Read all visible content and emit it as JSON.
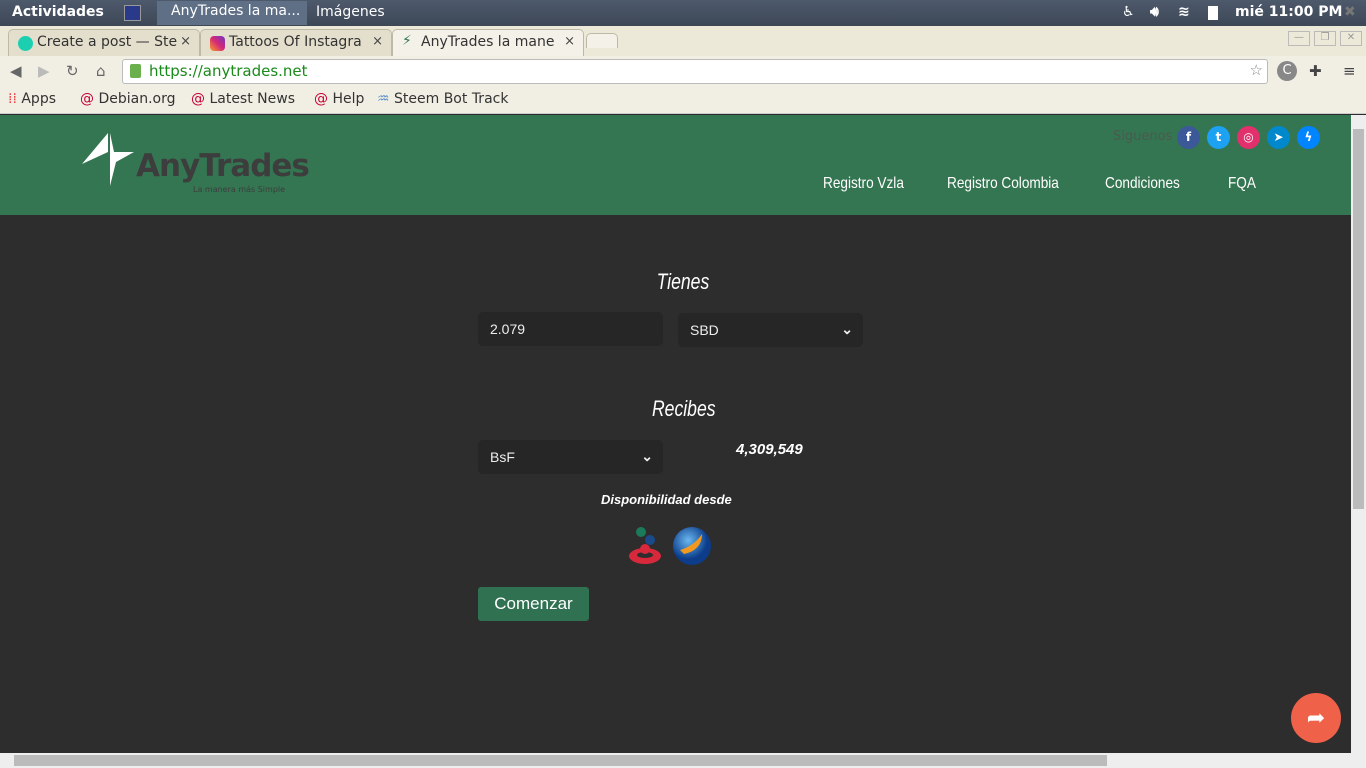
{
  "os": {
    "activities": "Actividades",
    "window1": "AnyTrades la ma...",
    "window2": "Imágenes",
    "clock": "mié 11:00 PM"
  },
  "browser": {
    "tabs": [
      {
        "label": "Create a post — Ste"
      },
      {
        "label": "Tattoos Of Instagra"
      },
      {
        "label": "AnyTrades la mane"
      }
    ],
    "url": "https://anytrades.net",
    "bookmarks": [
      {
        "label": "Apps"
      },
      {
        "label": "Debian.org"
      },
      {
        "label": "Latest News"
      },
      {
        "label": "Help"
      },
      {
        "label": "Steem Bot Track"
      }
    ]
  },
  "site": {
    "logo": {
      "name": "AnyTrades",
      "tagline": "La manera más Simple"
    },
    "follow": "Siguenos",
    "social": [
      "facebook",
      "twitter",
      "instagram",
      "telegram",
      "messenger"
    ],
    "nav": [
      {
        "label": "Registro Vzla"
      },
      {
        "label": "Registro Colombia"
      },
      {
        "label": "Condiciones"
      },
      {
        "label": "FQA"
      }
    ],
    "brand_color": "#347652"
  },
  "form": {
    "have_label": "Tienes",
    "amount": "2.079",
    "have_currency": "SBD",
    "receive_label": "Recibes",
    "receive_currency": "BsF",
    "receive_amount": "4,309,549",
    "availability": "Disponibilidad desde",
    "start_button": "Comenzar"
  }
}
